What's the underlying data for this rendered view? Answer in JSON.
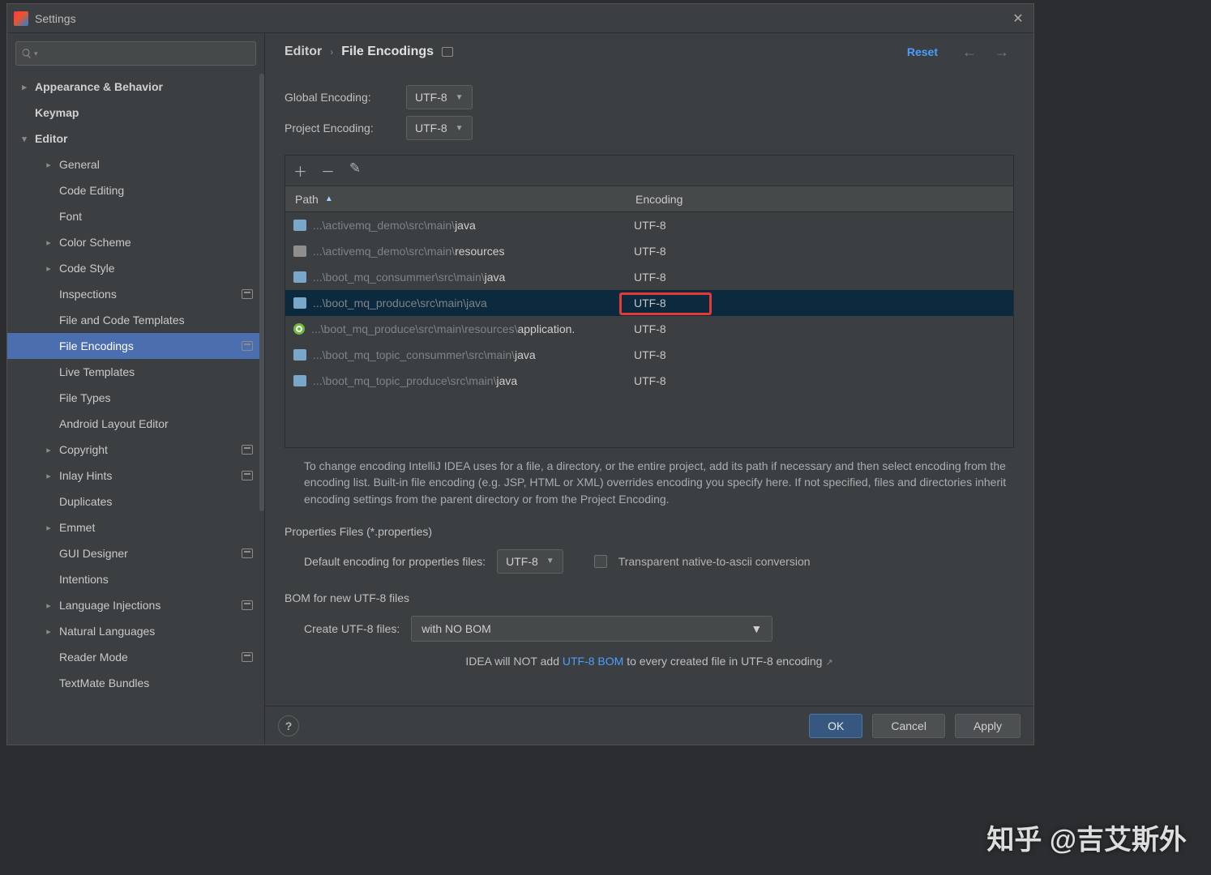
{
  "window": {
    "title": "Settings",
    "close_glyph": "✕"
  },
  "search": {
    "placeholder": ""
  },
  "sidebar": {
    "items": [
      {
        "label": "Appearance & Behavior",
        "level": 0,
        "expandable": true,
        "expanded": false,
        "bold": true
      },
      {
        "label": "Keymap",
        "level": 0,
        "expandable": false,
        "bold": true
      },
      {
        "label": "Editor",
        "level": 0,
        "expandable": true,
        "expanded": true,
        "bold": true
      },
      {
        "label": "General",
        "level": 1,
        "expandable": true,
        "expanded": false
      },
      {
        "label": "Code Editing",
        "level": 1,
        "expandable": false
      },
      {
        "label": "Font",
        "level": 1,
        "expandable": false
      },
      {
        "label": "Color Scheme",
        "level": 1,
        "expandable": true,
        "expanded": false
      },
      {
        "label": "Code Style",
        "level": 1,
        "expandable": true,
        "expanded": false
      },
      {
        "label": "Inspections",
        "level": 1,
        "expandable": false,
        "badge": true
      },
      {
        "label": "File and Code Templates",
        "level": 1,
        "expandable": false
      },
      {
        "label": "File Encodings",
        "level": 1,
        "expandable": false,
        "badge": true,
        "selected": true
      },
      {
        "label": "Live Templates",
        "level": 1,
        "expandable": false
      },
      {
        "label": "File Types",
        "level": 1,
        "expandable": false
      },
      {
        "label": "Android Layout Editor",
        "level": 1,
        "expandable": false
      },
      {
        "label": "Copyright",
        "level": 1,
        "expandable": true,
        "expanded": false,
        "badge": true
      },
      {
        "label": "Inlay Hints",
        "level": 1,
        "expandable": true,
        "expanded": false,
        "badge": true
      },
      {
        "label": "Duplicates",
        "level": 1,
        "expandable": false
      },
      {
        "label": "Emmet",
        "level": 1,
        "expandable": true,
        "expanded": false
      },
      {
        "label": "GUI Designer",
        "level": 1,
        "expandable": false,
        "badge": true
      },
      {
        "label": "Intentions",
        "level": 1,
        "expandable": false
      },
      {
        "label": "Language Injections",
        "level": 1,
        "expandable": true,
        "expanded": false,
        "badge": true
      },
      {
        "label": "Natural Languages",
        "level": 1,
        "expandable": true,
        "expanded": false
      },
      {
        "label": "Reader Mode",
        "level": 1,
        "expandable": false,
        "badge": true
      },
      {
        "label": "TextMate Bundles",
        "level": 1,
        "expandable": false
      }
    ]
  },
  "header": {
    "crumb1": "Editor",
    "crumb2": "File Encodings",
    "reset": "Reset",
    "back_glyph": "←",
    "fwd_glyph": "→"
  },
  "main": {
    "global_label": "Global Encoding:",
    "global_value": "UTF-8",
    "project_label": "Project Encoding:",
    "project_value": "UTF-8",
    "table": {
      "toolbar": {
        "add": "＋",
        "remove": "－",
        "edit": "✎"
      },
      "col_path": "Path",
      "col_encoding": "Encoding",
      "rows": [
        {
          "icon": "folder",
          "prefix": "...\\activemq_demo\\src\\main\\",
          "tail": "java",
          "encoding": "UTF-8"
        },
        {
          "icon": "res",
          "prefix": "...\\activemq_demo\\src\\main\\",
          "tail": "resources",
          "encoding": "UTF-8"
        },
        {
          "icon": "folder",
          "prefix": "...\\boot_mq_consummer\\src\\main\\",
          "tail": "java",
          "encoding": "UTF-8"
        },
        {
          "icon": "folder",
          "prefix": "...\\boot_mq_produce\\src\\main\\java",
          "tail": "",
          "encoding": "UTF-8",
          "selected": true,
          "highlight": true
        },
        {
          "icon": "spring",
          "prefix": "...\\boot_mq_produce\\src\\main\\resources\\",
          "tail": "application.",
          "encoding": "UTF-8"
        },
        {
          "icon": "folder",
          "prefix": "...\\boot_mq_topic_consummer\\src\\main\\",
          "tail": "java",
          "encoding": "UTF-8"
        },
        {
          "icon": "folder",
          "prefix": "...\\boot_mq_topic_produce\\src\\main\\",
          "tail": "java",
          "encoding": "UTF-8"
        }
      ]
    },
    "help_text": "To change encoding IntelliJ IDEA uses for a file, a directory, or the entire project, add its path if necessary and then select encoding from the encoding list. Built-in file encoding (e.g. JSP, HTML or XML) overrides encoding you specify here. If not specified, files and directories inherit encoding settings from the parent directory or from the Project Encoding.",
    "props_section": "Properties Files (*.properties)",
    "props_label": "Default encoding for properties files:",
    "props_value": "UTF-8",
    "transparent_label": "Transparent native-to-ascii conversion",
    "bom_section": "BOM for new UTF-8 files",
    "bom_label": "Create UTF-8 files:",
    "bom_value": "with NO BOM",
    "bom_note_prefix": "IDEA will NOT add ",
    "bom_link": "UTF-8 BOM",
    "bom_note_suffix": " to every created file in UTF-8 encoding"
  },
  "footer": {
    "help": "?",
    "ok": "OK",
    "cancel": "Cancel",
    "apply": "Apply"
  },
  "watermark": "知乎 @吉艾斯外"
}
